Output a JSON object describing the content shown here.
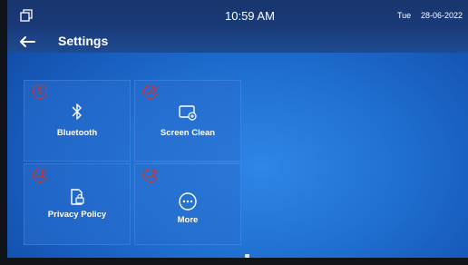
{
  "statusbar": {
    "time": "10:59 AM",
    "day": "Tue",
    "date": "28-06-2022",
    "icon": "window-icon"
  },
  "header": {
    "title": "Settings",
    "back_icon": "back-arrow-icon"
  },
  "tiles": [
    {
      "number": "9",
      "label": "Bluetooth",
      "icon": "bluetooth-icon"
    },
    {
      "number": "10",
      "label": "Screen Clean",
      "icon": "screen-clean-icon"
    },
    {
      "number": "11",
      "label": "Privacy Policy",
      "icon": "privacy-policy-icon"
    },
    {
      "number": "12",
      "label": "More",
      "icon": "more-icon"
    }
  ],
  "colors": {
    "accent": "#1f6fd0",
    "header": "#1b3f80",
    "marker": "#d0342c"
  }
}
